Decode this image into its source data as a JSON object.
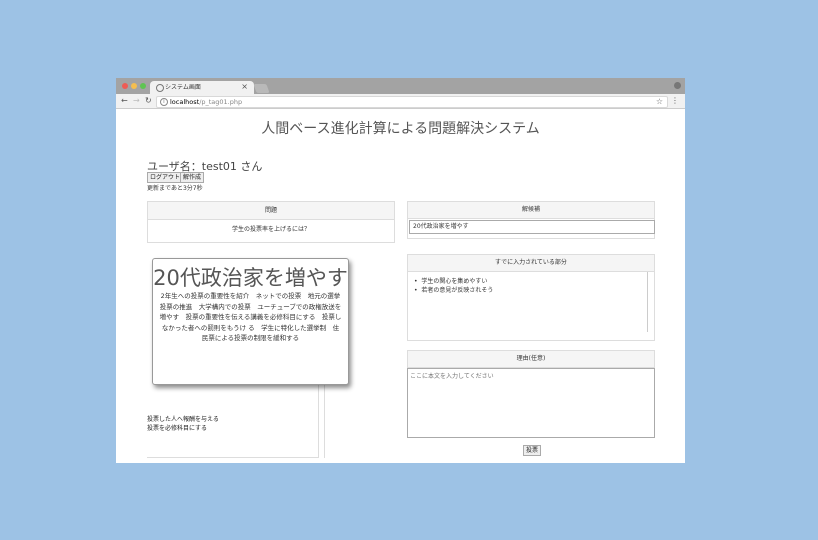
{
  "browser": {
    "tab_title": "システム画面",
    "url_host": "localhost",
    "url_path": "/p_tag01.php"
  },
  "page": {
    "title": "人間ベース進化計算による問題解決システム",
    "username": "ユーザ名：test01 さん",
    "logout_label": "ログアウト",
    "answer_label": "解作成",
    "timer_text": "更新まであと3分7秒"
  },
  "problem": {
    "header": "問題",
    "text": "学生の投票率を上げるには？"
  },
  "candidate": {
    "header": "解候補",
    "value": "20代政治家を増やす"
  },
  "already_entered": {
    "header": "すでに入力されている部分",
    "items": [
      "学生の関心を集めやすい",
      "若者の意見が反映されそう"
    ]
  },
  "reason": {
    "header": "理由(任意)",
    "placeholder": "ここに本文を入力してください"
  },
  "vote_label": "投票",
  "popup": {
    "big_text": "20代政治家を増やす",
    "small_text": "2年生への投票の重要性を紹介　ネットでの投票　地元の選挙投票の推進　大学構内での投票　ユーチューブでの政権放送を増やす　投票の重要性を伝える講義を必修科目にする　投票しなかった者への罰則をもうけ る　学生に特化した選挙制　住民票による投票の制限を緩和する"
  },
  "background_list": [
    "投票した人へ報酬を与える",
    "投票を必修科目にする"
  ],
  "colors": {
    "page_bg": "#9dc2e5",
    "close_dot": "#ee5c55",
    "minimize_dot": "#f5be4f",
    "zoom_dot": "#5fc452"
  }
}
